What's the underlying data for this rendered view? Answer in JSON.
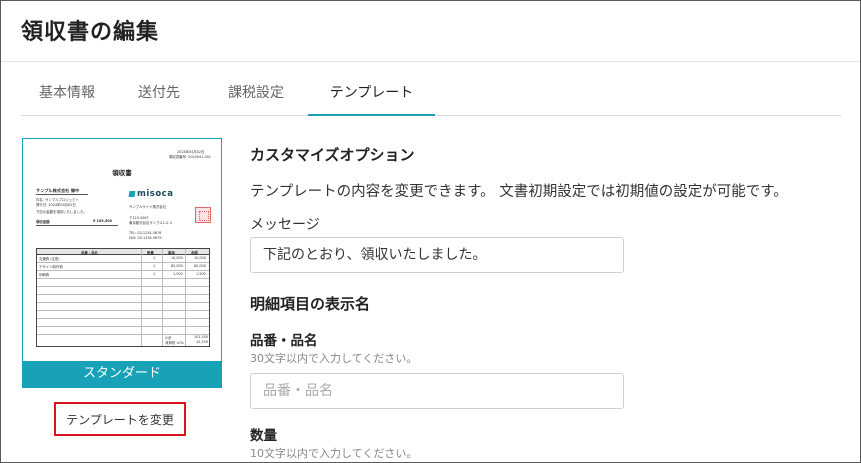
{
  "page": {
    "title": "領収書の編集"
  },
  "tabs": [
    {
      "label": "基本情報",
      "active": false
    },
    {
      "label": "送付先",
      "active": false
    },
    {
      "label": "課税設定",
      "active": false
    },
    {
      "label": "テンプレート",
      "active": true
    }
  ],
  "template_preview": {
    "caption": "スタンダード",
    "doc_title": "領収書",
    "logo_text": "misoca",
    "date_text": "2024年04月02日",
    "number_text": "領収書番号: 2024041-001",
    "recipient": "サンプル株式会社 御中",
    "rows": [
      "交通費 (往復)",
      "デザイン制作費",
      "印刷費"
    ],
    "change_button": "テンプレートを変更"
  },
  "customize": {
    "heading": "カスタマイズオプション",
    "description": "テンプレートの内容を変更できます。 文書初期設定では初期値の設定が可能です。",
    "message_label": "メッセージ",
    "message_value": "下記のとおり、領収いたしました。"
  },
  "items": {
    "heading": "明細項目の表示名",
    "name_label": "品番・品名",
    "name_hint": "30文字以内で入力してください。",
    "name_placeholder": "品番・品名",
    "qty_label": "数量",
    "qty_hint": "10文字以内で入力してください。"
  },
  "colors": {
    "accent": "#17a2b8",
    "highlight_border": "#d9141b"
  }
}
